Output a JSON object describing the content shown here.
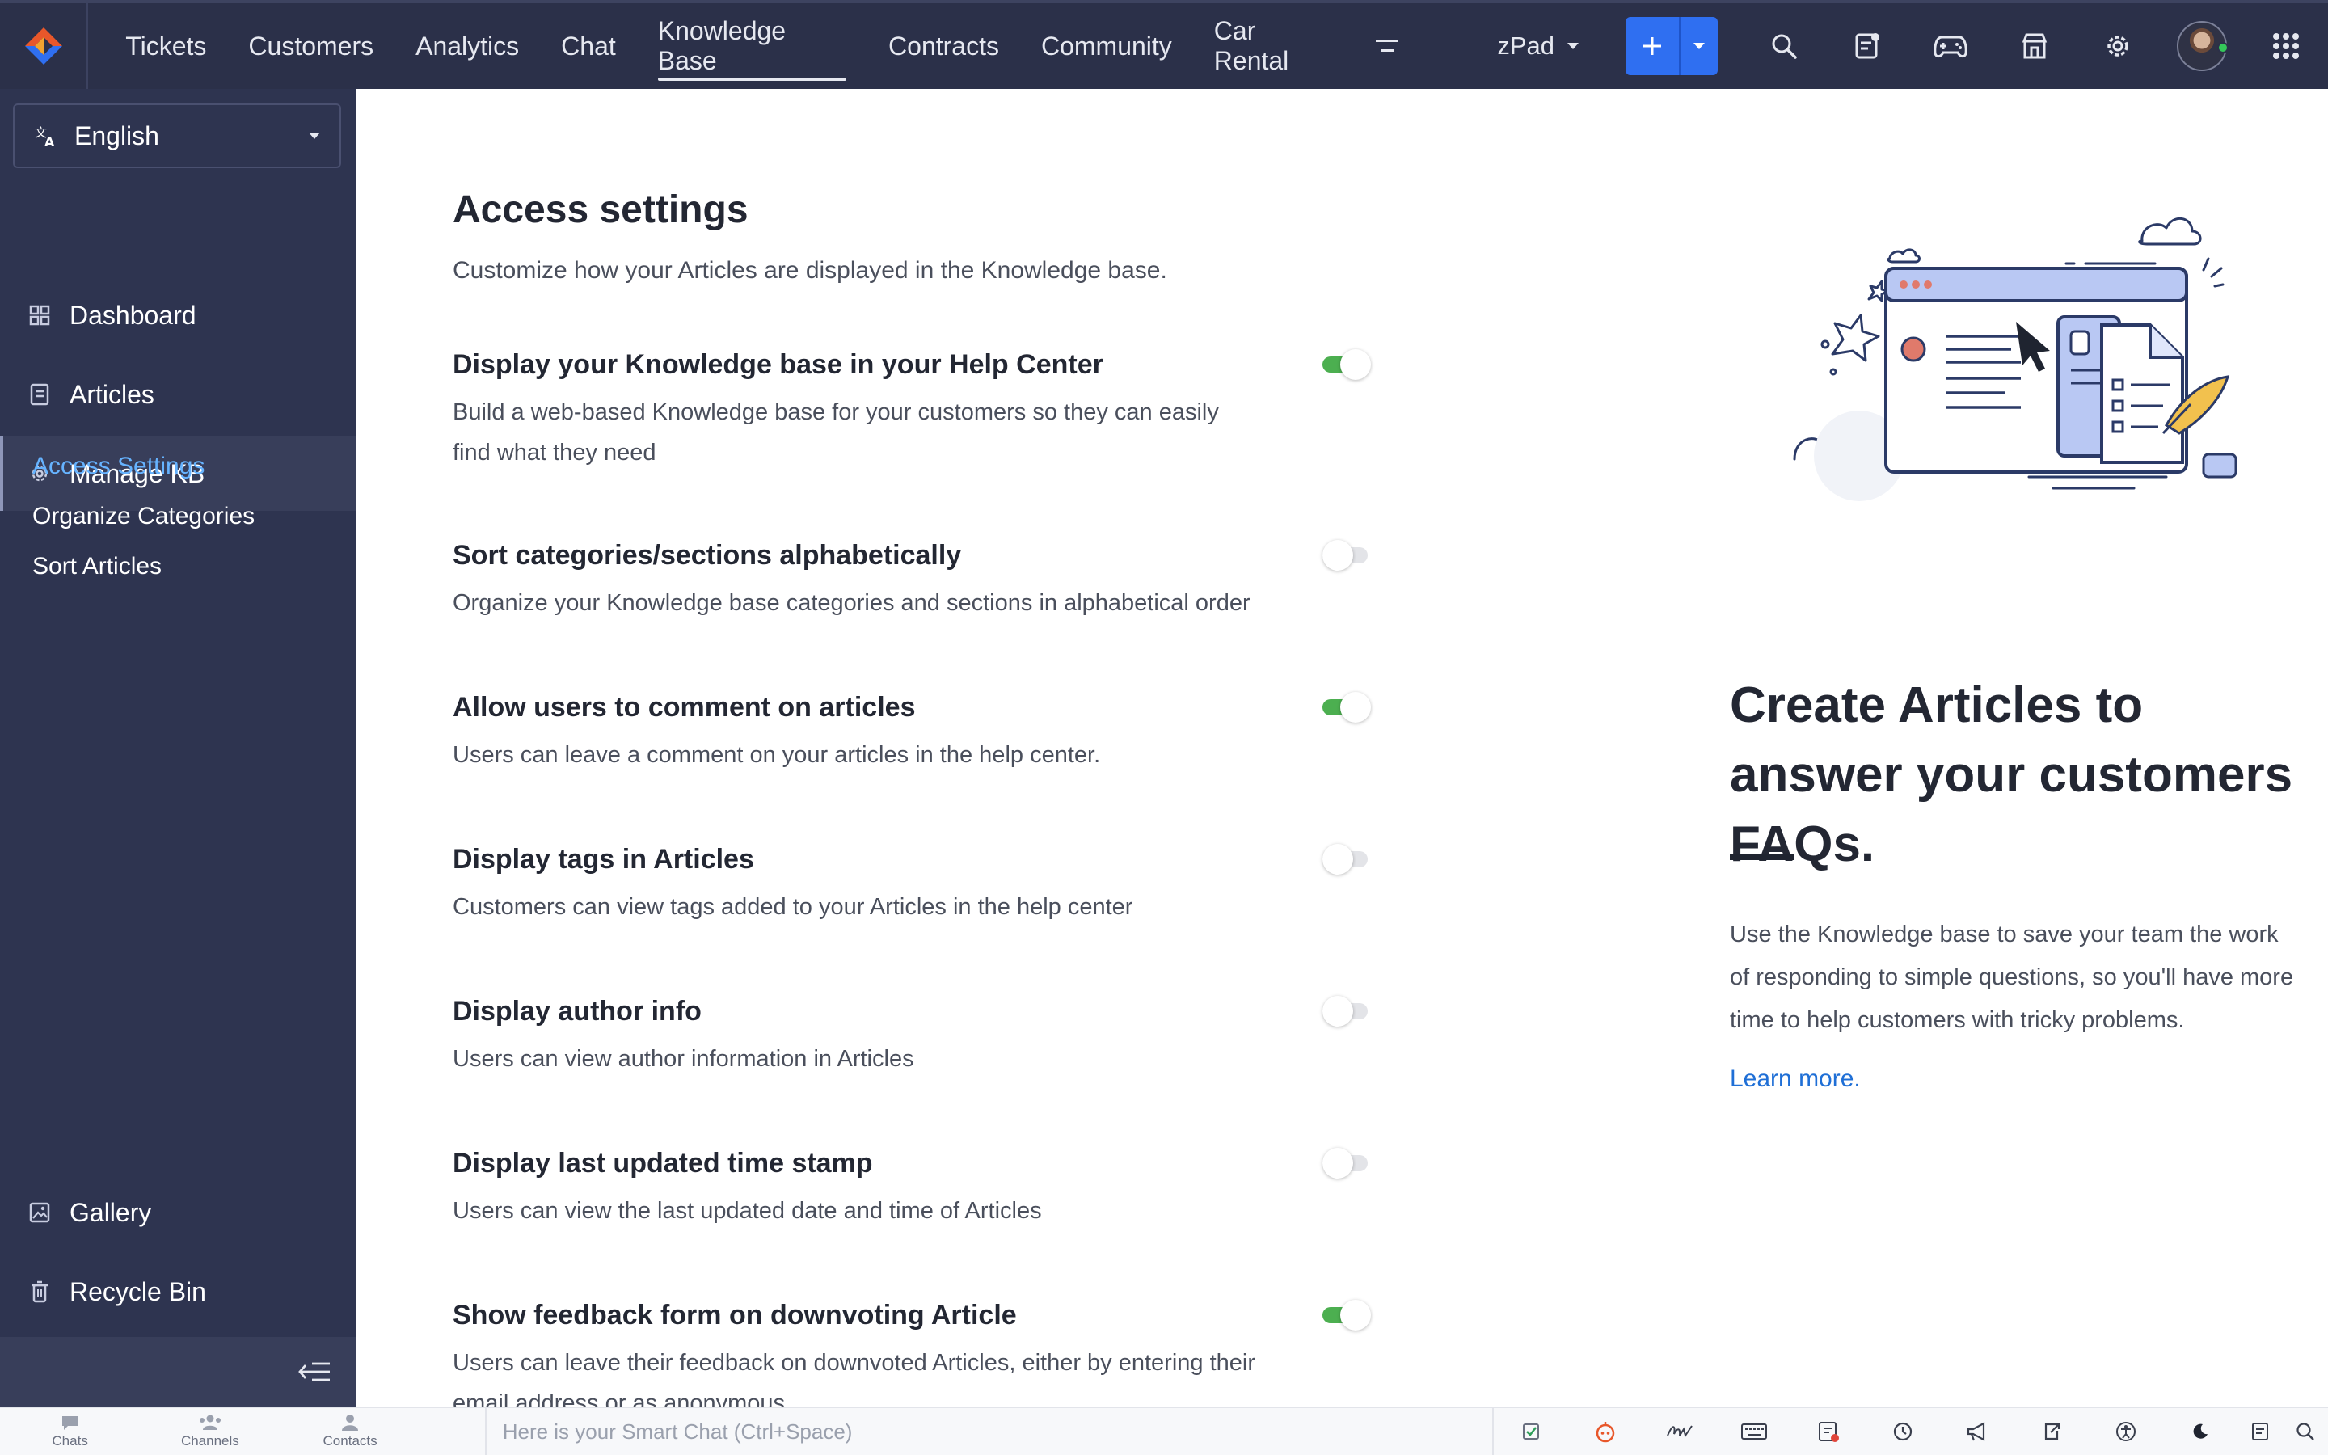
{
  "topbar": {
    "nav": [
      "Tickets",
      "Customers",
      "Analytics",
      "Chat",
      "Knowledge Base",
      "Contracts",
      "Community",
      "Car Rental"
    ],
    "active_nav": "Knowledge Base",
    "department": "zPad",
    "accent_color": "#2f6ff1",
    "icons": [
      "search-icon",
      "notes-icon",
      "gamepad-icon",
      "store-icon",
      "gear-icon",
      "avatar",
      "app-grid-icon"
    ]
  },
  "sidebar": {
    "language": "English",
    "items": [
      "Dashboard",
      "Articles",
      "Manage KB"
    ],
    "active_item": "Manage KB",
    "sub_items": [
      "Access Settings",
      "Organize Categories",
      "Sort Articles"
    ],
    "active_sub_item": "Access Settings",
    "bottom_items": [
      "Gallery",
      "Recycle Bin"
    ]
  },
  "main": {
    "title": "Access settings",
    "subtitle": "Customize how your Articles are displayed in the Knowledge base.",
    "settings": [
      {
        "title": "Display your Knowledge base in your Help Center",
        "desc": "Build a web-based Knowledge base for your customers so they can easily find what they need",
        "enabled": true
      },
      {
        "title": "Sort categories/sections alphabetically",
        "desc": "Organize your Knowledge base categories and sections in alphabetical order",
        "enabled": false
      },
      {
        "title": "Allow users to comment on articles",
        "desc": "Users can leave a comment on your articles in the help center.",
        "enabled": true
      },
      {
        "title": "Display tags in Articles",
        "desc": "Customers can view tags added to your Articles in the help center",
        "enabled": false
      },
      {
        "title": "Display author info",
        "desc": "Users can view author information in Articles",
        "enabled": false
      },
      {
        "title": "Display last updated time stamp",
        "desc": "Users can view the last updated date and time of Articles",
        "enabled": false
      },
      {
        "title": "Show feedback form on downvoting Article",
        "desc": "Users can leave their feedback on downvoted Articles, either by entering their email address or as anonymous",
        "enabled": true
      }
    ],
    "toggle_on_color": "#4caf50"
  },
  "promo": {
    "title": "Create Articles to answer your customers FAQs.",
    "text": "Use the Knowledge base to save your team the work of responding to simple questions, so you'll have more time to help customers with tricky problems.",
    "link": "Learn more."
  },
  "bottombar": {
    "tabs": [
      "Chats",
      "Channels",
      "Contacts"
    ],
    "smart_chat_placeholder": "Here is your Smart Chat (Ctrl+Space)"
  }
}
